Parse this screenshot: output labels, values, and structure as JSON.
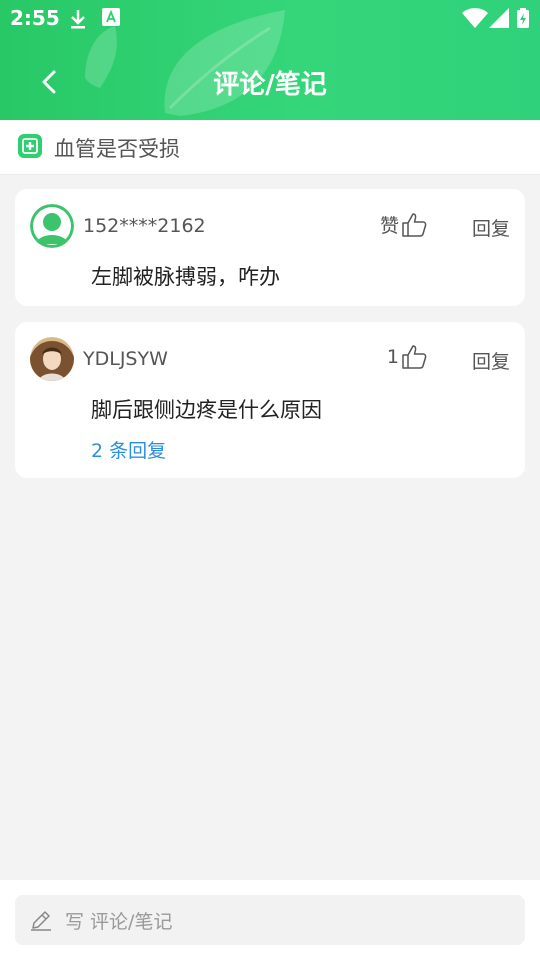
{
  "status_bar": {
    "time": "2:55"
  },
  "header": {
    "title": "评论/笔记"
  },
  "topic": {
    "title": "血管是否受损"
  },
  "comments": [
    {
      "user": "152****2162",
      "like_label": "赞",
      "reply_label": "回复",
      "text": "左脚被脉搏弱，咋办",
      "avatar": "default-avatar"
    },
    {
      "user": "YDLJSYW",
      "like_label": "1",
      "reply_label": "回复",
      "text": "脚后跟侧边疼是什么原因",
      "replies_label": "2 条回复",
      "avatar": "photo-avatar"
    }
  ],
  "composer": {
    "placeholder": "写 评论/笔记"
  },
  "colors": {
    "brand_green": "#2ecf70",
    "link_blue": "#2a8fe0"
  }
}
